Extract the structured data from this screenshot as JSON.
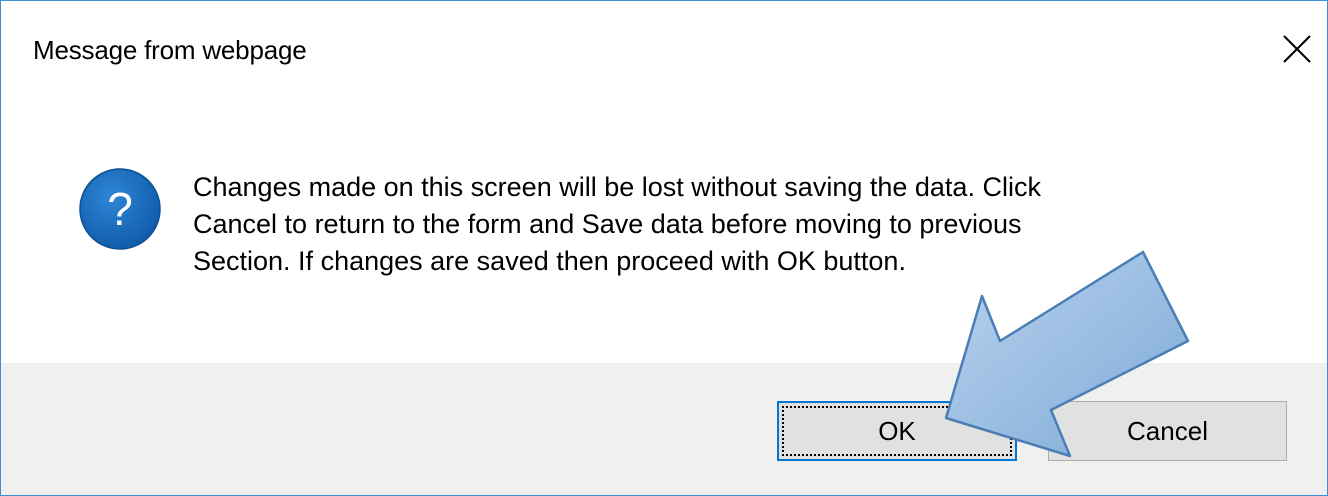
{
  "window": {
    "title": "Message from webpage",
    "close_icon": "close-icon"
  },
  "message": {
    "icon": "question-icon",
    "icon_glyph": "?",
    "lines": [
      "Changes made on this screen will be lost without saving the data. Click",
      "Cancel to return to the form and Save data before moving to previous",
      "Section. If changes are saved then proceed with OK button."
    ]
  },
  "buttons": {
    "ok_label": "OK",
    "cancel_label": "Cancel"
  },
  "colors": {
    "accent": "#0078d7",
    "icon_blue": "#1b6ec2",
    "arrow_fill": "#8fb6dd",
    "arrow_stroke": "#4a7eb4"
  }
}
